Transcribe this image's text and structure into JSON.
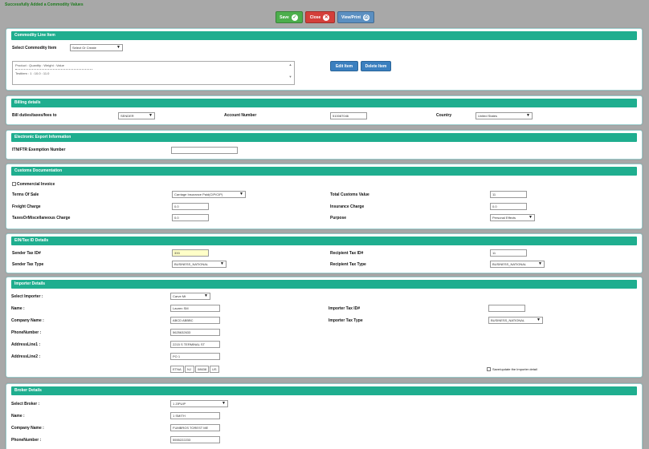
{
  "status_message": "Successfully Added a Commodity Values",
  "toolbar": {
    "save": "Save",
    "close": "Close",
    "view_print": "View/Print"
  },
  "icons": {
    "save": "check-circle-icon",
    "close": "x-circle-icon",
    "view_print": "printer-icon"
  },
  "colors": {
    "header": "#1fae8f",
    "save": "#4cae4c",
    "close": "#d43f3a",
    "view_print": "#5b8fc1",
    "action": "#3a7fbf",
    "success": "#1e7b1e"
  },
  "commodity": {
    "title": "Commodity Line Item",
    "select_label": "Select Commodity Item",
    "select_value": "Select Or Create",
    "list_header": "Product : Quantity : Weight : Value",
    "list_row": "Testitem : 1 : 10.0 : 11.0",
    "edit_item": "Edit Item",
    "delete_item": "Delete Item"
  },
  "billing": {
    "title": "Billing details",
    "bill_label": "Bill duties/taxes/fees to",
    "bill_value": "SENDER",
    "account_label": "Account Number",
    "account_value": "510087046",
    "country_label": "Country",
    "country_value": "United States"
  },
  "export": {
    "title": "Electronic Export Information",
    "itn_label": "ITN/FTR Exemption Number",
    "itn_value": ""
  },
  "customs": {
    "title": "Customs Documentation",
    "commercial_invoice": "Commercial Invoice",
    "terms_label": "Terms Of Sale",
    "terms_value": "Carriage Insurance Paid(CIP/CIP)",
    "total_label": "Total Customs Value",
    "total_value": "11",
    "freight_label": "Freight Charge",
    "freight_value": "0.0",
    "insurance_label": "Insurance Charge",
    "insurance_value": "0.0",
    "taxes_label": "TaxesOrMiscellaneous Charge",
    "taxes_value": "0.0",
    "purpose_label": "Purpose",
    "purpose_value": "Personal Effects"
  },
  "ein": {
    "title": "EIN/Tax ID Details",
    "sender_id_label": "Sender Tax ID#",
    "sender_id_value": "333",
    "recipient_id_label": "Recipient Tax ID#",
    "recipient_id_value": "11",
    "sender_type_label": "Sender Tax Type",
    "sender_type_value": "BUSINESS_NATIONAL",
    "recipient_type_label": "Recipient Tax Type",
    "recipient_type_value": "BUSINESS_NATIONAL"
  },
  "importer": {
    "title": "Importer Details",
    "select_label": "Select Importer :",
    "select_value": "Carve Mt",
    "name_label": "Name :",
    "name_value": "Lauren SM",
    "importer_tax_label": "Importer Tax ID#",
    "importer_tax_value": "",
    "company_label": "Company Name :",
    "company_value": "ABCD ABBBC",
    "importer_type_label": "Importer Tax Type",
    "importer_type_value": "BUSINESS_NATIONAL",
    "phone_label": "PhoneNumber :",
    "phone_value": "5625632633",
    "addr1_label": "AddressLine1 :",
    "addr1_value": "2215 S TERMINAL ST",
    "addr2_label": "AddressLine2 :",
    "addr2_value": "PO 1",
    "city_value": "ETNA",
    "state_value": "NJ",
    "zip_value": "08638",
    "country_value": "US",
    "same_as_label": "Save/update the Importer detail"
  },
  "broker": {
    "title": "Broker Details",
    "select_label": "Select Broker :",
    "select_value": "1 ZIPUIP",
    "name_label": "Name :",
    "name_value": "1 SMITH",
    "company_label": "Company Name :",
    "company_value": "FUMBROS TOREST ME",
    "phone_label": "PhoneNumber :",
    "phone_value": "5555222233"
  }
}
